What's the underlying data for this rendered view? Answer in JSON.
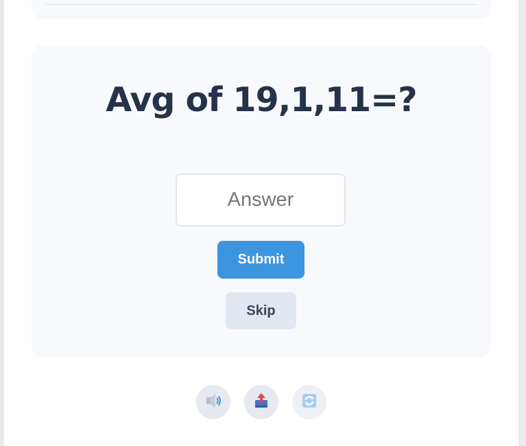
{
  "quiz": {
    "question": "Avg of 19,1,11=?",
    "answer_placeholder": "Answer",
    "answer_value": "",
    "submit_label": "Submit",
    "skip_label": "Skip"
  },
  "toolbar": {
    "icons": [
      "speaker-icon",
      "share-upload-icon",
      "refresh-icon"
    ]
  },
  "colors": {
    "accent": "#3d95e0",
    "heading": "#26324a",
    "card_background": "#f7f9fc",
    "skip_background": "#e2e8f1"
  }
}
